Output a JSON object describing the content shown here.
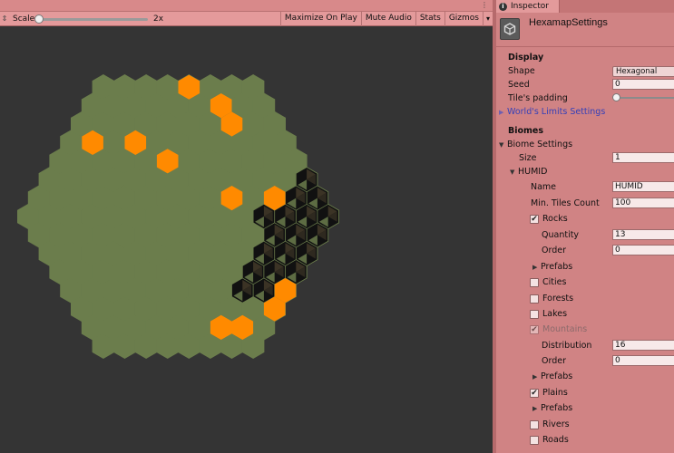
{
  "game_toolbar": {
    "scale_label": "Scale",
    "scale_value": "2x",
    "scale_fraction": 0.0,
    "buttons": [
      "Maximize On Play",
      "Mute Audio",
      "Stats",
      "Gizmos"
    ],
    "gizmos_arrow": "▾",
    "menu_glyph": "⋮",
    "display_arrows": "⇕"
  },
  "hexmap": {
    "colors": {
      "background": "#343434",
      "plain": "#6b7d4c",
      "rock": "#ff8a00",
      "mountain_dark": "#111111",
      "mountain_mid": "#3b3325",
      "mountain_light": "#6b7d4c"
    }
  },
  "inspector": {
    "tab_label": "Inspector",
    "info_icon": "i",
    "title": "HexamapSettings",
    "display": {
      "section_label": "Display",
      "shape_label": "Shape",
      "shape_value": "Hexagonal",
      "seed_label": "Seed",
      "seed_value": "0",
      "padding_label": "Tile's padding",
      "padding_fraction": 0.0,
      "world_limits_label": "World's Limits Settings"
    },
    "biomes": {
      "section_label": "Biomes",
      "biome_settings_label": "Biome Settings",
      "size_label": "Size",
      "size_value": "1",
      "humid_label": "HUMID",
      "name_label": "Name",
      "name_value": "HUMID",
      "min_tiles_label": "Min. Tiles Count",
      "min_tiles_value": "100",
      "rocks_label": "Rocks",
      "rocks_checked": true,
      "rocks_quantity_label": "Quantity",
      "rocks_quantity_value": "13",
      "rocks_order_label": "Order",
      "rocks_order_value": "0",
      "rocks_prefabs_label": "Prefabs",
      "cities_label": "Cities",
      "forests_label": "Forests",
      "lakes_label": "Lakes",
      "mountains_label": "Mountains",
      "mountains_distribution_label": "Distribution",
      "mountains_distribution_value": "16",
      "mountains_order_label": "Order",
      "mountains_order_value": "0",
      "mountains_prefabs_label": "Prefabs",
      "plains_label": "Plains",
      "plains_prefabs_label": "Prefabs",
      "rivers_label": "Rivers",
      "roads_label": "Roads",
      "check_glyph": "✔",
      "fold_open": "▼",
      "fold_closed": "▶"
    }
  }
}
